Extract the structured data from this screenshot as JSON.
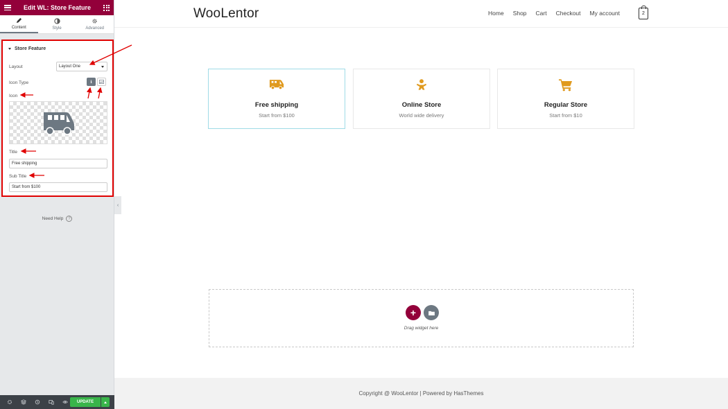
{
  "editor": {
    "title": "Edit WL: Store Feature",
    "tabs": [
      {
        "label": "Content",
        "icon": "pencil-icon",
        "active": true
      },
      {
        "label": "Style",
        "icon": "half-circle-icon",
        "active": false
      },
      {
        "label": "Advanced",
        "icon": "gear-icon",
        "active": false
      }
    ],
    "section": {
      "title": "Store Feature",
      "layout_label": "Layout",
      "layout_value": "Layout One",
      "icon_type_label": "Icon Type",
      "icon_label": "Icon",
      "title_label": "Title",
      "title_value": "Free shipping",
      "subtitle_label": "Sub Title",
      "subtitle_value": "Start from $100"
    },
    "need_help": "Need Help",
    "update_label": "UPDATE",
    "annotation_color": "#e00000"
  },
  "site": {
    "logo": "WooLentor",
    "nav": [
      "Home",
      "Shop",
      "Cart",
      "Checkout",
      "My account"
    ],
    "cart_count": "2",
    "accent_color": "#e09a1e",
    "features": [
      {
        "title": "Free shipping",
        "subtitle": "Start from $100",
        "icon": "truck-icon"
      },
      {
        "title": "Online Store",
        "subtitle": "World wide delivery",
        "icon": "baby-icon"
      },
      {
        "title": "Regular Store",
        "subtitle": "Start from $10",
        "icon": "cart-icon"
      }
    ],
    "drop_text": "Drag widget here",
    "footer": "Copyright @ WooLentor | Powered by HasThemes"
  }
}
